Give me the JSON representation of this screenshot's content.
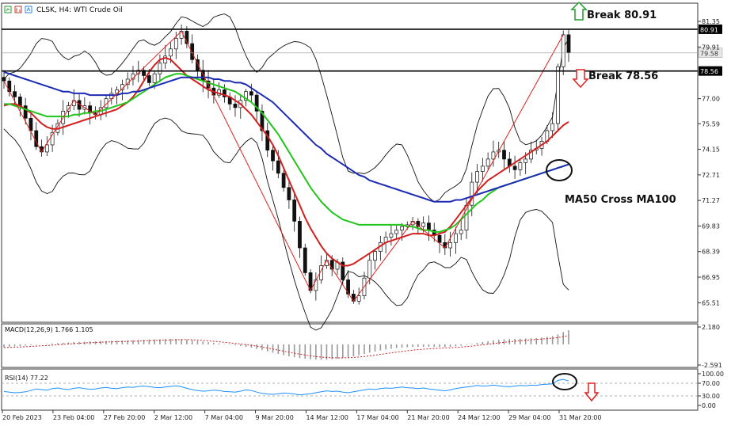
{
  "header": {
    "title": "CLSK, H4:  WTI Crude Oil"
  },
  "annotations": {
    "break_up": "Break 80.91",
    "break_down": "Break 78.56",
    "ma_cross": "MA50 Cross MA100"
  },
  "colors": {
    "candle": "#111111",
    "ma_fast": "#d21f1f",
    "ma_mid": "#22c51a",
    "ma_slow": "#1c2bb4",
    "bands": "#111111",
    "zigzag": "#e0211d",
    "macd": "#999999",
    "macd_signal": "#cc2222",
    "rsi": "#1e90ff",
    "arrow_up": "#1f9e2e",
    "arrow_down": "#e02020"
  },
  "chart_data": [
    {
      "type": "line",
      "panel": "price",
      "symbol": "CLSK",
      "timeframe": "H4",
      "ylim": [
        64.5,
        82.2
      ],
      "y_ticks": [
        "81.35",
        "79.91",
        "77.00",
        "75.59",
        "74.15",
        "72.71",
        "71.27",
        "69.83",
        "68.39",
        "66.95",
        "65.51"
      ],
      "current_price": "79.58",
      "levels": [
        {
          "value": 80.91,
          "label": "80.91"
        },
        {
          "value": 78.56,
          "label": "78.56"
        }
      ],
      "x_labels": [
        "20 Feb 2023",
        "23 Feb 04:00",
        "27 Feb 20:00",
        "2 Mar 12:00",
        "7 Mar 04:00",
        "9 Mar 20:00",
        "14 Mar 12:00",
        "17 Mar 04:00",
        "21 Mar 20:00",
        "24 Mar 12:00",
        "29 Mar 04:00",
        "31 Mar 20:00"
      ],
      "close": [
        78.0,
        77.4,
        77.1,
        76.6,
        75.9,
        75.2,
        74.3,
        74.0,
        74.4,
        75.1,
        75.6,
        76.3,
        76.6,
        76.9,
        76.4,
        76.6,
        76.2,
        76.1,
        76.5,
        77.0,
        77.3,
        77.5,
        77.8,
        78.1,
        78.4,
        78.6,
        78.3,
        77.9,
        78.4,
        79.0,
        79.4,
        79.8,
        80.4,
        80.8,
        80.1,
        79.2,
        78.6,
        78.0,
        77.6,
        77.2,
        77.5,
        77.1,
        76.7,
        76.5,
        76.9,
        77.4,
        77.2,
        76.3,
        75.2,
        74.1,
        73.5,
        72.8,
        72.0,
        71.3,
        70.1,
        68.6,
        67.2,
        66.2,
        66.8,
        67.6,
        67.9,
        67.4,
        67.8,
        66.8,
        66.0,
        65.6,
        65.9,
        66.9,
        67.9,
        68.4,
        68.9,
        69.2,
        69.4,
        69.6,
        69.8,
        69.9,
        70.1,
        69.8,
        70.0,
        69.6,
        69.3,
        68.9,
        68.6,
        68.9,
        69.4,
        69.6,
        71.0,
        72.3,
        72.9,
        73.2,
        73.6,
        74.0,
        74.1,
        73.6,
        73.2,
        73.0,
        73.4,
        73.6,
        74.1,
        74.2,
        74.6,
        75.2,
        75.6,
        78.8,
        80.6,
        79.6
      ],
      "series": [
        {
          "role": "ma_fast",
          "values": [
            76.6,
            76.7,
            76.7,
            76.6,
            76.4,
            76.2,
            75.9,
            75.6,
            75.4,
            75.3,
            75.3,
            75.4,
            75.5,
            75.6,
            75.7,
            75.8,
            75.9,
            76.0,
            76.1,
            76.2,
            76.3,
            76.4,
            76.6,
            76.8,
            77.1,
            77.5,
            78.0,
            78.5,
            78.9,
            79.2,
            79.3,
            79.2,
            78.9,
            78.6,
            78.3,
            78.1,
            77.9,
            77.7,
            77.5,
            77.4,
            77.3,
            77.2,
            77.1,
            76.9,
            76.7,
            76.4,
            76.1,
            75.7,
            75.3,
            74.9,
            74.4,
            73.8,
            73.1,
            72.4,
            71.7,
            71.0,
            70.3,
            69.7,
            69.2,
            68.7,
            68.3,
            68.0,
            67.8,
            67.6,
            67.6,
            67.7,
            67.9,
            68.1,
            68.3,
            68.5,
            68.7,
            68.9,
            69.0,
            69.1,
            69.2,
            69.3,
            69.4,
            69.4,
            69.4,
            69.3,
            69.3,
            69.4,
            69.5,
            69.8,
            70.2,
            70.6,
            71.0,
            71.4,
            71.8,
            72.1,
            72.4,
            72.6,
            72.8,
            73.0,
            73.2,
            73.4,
            73.6,
            73.8,
            74.0,
            74.2,
            74.4,
            74.6,
            74.9,
            75.2,
            75.5,
            75.7
          ]
        },
        {
          "role": "ma_mid",
          "values": [
            76.7,
            76.7,
            76.6,
            76.5,
            76.4,
            76.3,
            76.2,
            76.1,
            76.0,
            76.0,
            76.0,
            76.0,
            76.0,
            76.1,
            76.1,
            76.2,
            76.2,
            76.3,
            76.3,
            76.4,
            76.5,
            76.6,
            76.7,
            76.8,
            77.0,
            77.2,
            77.4,
            77.6,
            77.8,
            78.0,
            78.2,
            78.3,
            78.4,
            78.4,
            78.3,
            78.2,
            78.1,
            78.0,
            77.9,
            77.8,
            77.7,
            77.6,
            77.5,
            77.4,
            77.2,
            77.0,
            76.8,
            76.5,
            76.2,
            75.8,
            75.4,
            75.0,
            74.5,
            74.0,
            73.5,
            73.0,
            72.5,
            72.0,
            71.6,
            71.2,
            70.9,
            70.6,
            70.4,
            70.2,
            70.1,
            70.0,
            69.9,
            69.9,
            69.9,
            69.9,
            69.9,
            69.9,
            69.9,
            69.9,
            69.9,
            69.8,
            69.8,
            69.7,
            69.6,
            69.6,
            69.5,
            69.5,
            69.6,
            69.7,
            69.9,
            70.2,
            70.5,
            70.8,
            71.1,
            71.3,
            71.6,
            71.8,
            72.0,
            72.1,
            72.2,
            72.3,
            72.4,
            72.5,
            72.6,
            72.7,
            72.8,
            72.9,
            73.0,
            73.1,
            73.2,
            73.3
          ]
        },
        {
          "role": "ma_slow",
          "values": [
            78.5,
            78.4,
            78.3,
            78.2,
            78.1,
            78.0,
            77.9,
            77.8,
            77.7,
            77.6,
            77.5,
            77.4,
            77.4,
            77.3,
            77.3,
            77.3,
            77.2,
            77.2,
            77.2,
            77.2,
            77.2,
            77.2,
            77.3,
            77.3,
            77.4,
            77.4,
            77.5,
            77.6,
            77.7,
            77.8,
            77.9,
            78.0,
            78.1,
            78.2,
            78.2,
            78.2,
            78.2,
            78.2,
            78.2,
            78.1,
            78.1,
            78.0,
            78.0,
            77.9,
            77.9,
            77.8,
            77.6,
            77.4,
            77.2,
            77.0,
            76.8,
            76.5,
            76.2,
            75.9,
            75.6,
            75.3,
            75.0,
            74.7,
            74.4,
            74.2,
            73.9,
            73.7,
            73.5,
            73.3,
            73.1,
            72.9,
            72.7,
            72.6,
            72.4,
            72.3,
            72.2,
            72.1,
            72.0,
            71.9,
            71.8,
            71.7,
            71.6,
            71.5,
            71.4,
            71.3,
            71.2,
            71.2,
            71.2,
            71.2,
            71.3,
            71.3,
            71.4,
            71.5,
            71.6,
            71.7,
            71.8,
            71.9,
            72.0,
            72.1,
            72.2,
            72.3,
            72.4,
            72.5,
            72.6,
            72.7,
            72.8,
            72.9,
            73.0,
            73.1,
            73.2,
            73.3
          ]
        }
      ],
      "zigzag": [
        [
          0,
          78.0
        ],
        [
          7,
          74.0
        ],
        [
          13,
          76.9
        ],
        [
          17,
          76.1
        ],
        [
          33,
          80.8
        ],
        [
          57,
          66.2
        ],
        [
          60,
          67.9
        ],
        [
          65,
          65.6
        ],
        [
          76,
          70.1
        ],
        [
          82,
          68.6
        ],
        [
          104,
          80.6
        ]
      ]
    },
    {
      "type": "bar",
      "panel": "macd",
      "title": "MACD(12,26,9) 1.766 1.105",
      "y_ticks": [
        "2.180",
        "-2.591"
      ],
      "ylim": [
        -2.591,
        2.18
      ],
      "values": [
        -0.35,
        -0.3,
        -0.25,
        -0.2,
        -0.15,
        -0.1,
        -0.05,
        0.0,
        0.05,
        0.1,
        0.15,
        0.2,
        0.25,
        0.3,
        0.32,
        0.34,
        0.36,
        0.38,
        0.4,
        0.42,
        0.44,
        0.46,
        0.48,
        0.5,
        0.52,
        0.55,
        0.58,
        0.6,
        0.62,
        0.64,
        0.66,
        0.68,
        0.7,
        0.66,
        0.6,
        0.52,
        0.44,
        0.36,
        0.28,
        0.2,
        0.12,
        0.04,
        -0.04,
        -0.12,
        -0.2,
        -0.3,
        -0.42,
        -0.56,
        -0.72,
        -0.88,
        -1.04,
        -1.2,
        -1.36,
        -1.5,
        -1.62,
        -1.72,
        -1.8,
        -1.86,
        -1.9,
        -1.92,
        -1.9,
        -1.86,
        -1.8,
        -1.72,
        -1.62,
        -1.5,
        -1.36,
        -1.2,
        -1.04,
        -0.9,
        -0.76,
        -0.64,
        -0.54,
        -0.46,
        -0.4,
        -0.36,
        -0.33,
        -0.31,
        -0.3,
        -0.3,
        -0.31,
        -0.32,
        -0.33,
        -0.3,
        -0.24,
        -0.16,
        -0.06,
        0.06,
        0.18,
        0.3,
        0.4,
        0.5,
        0.58,
        0.64,
        0.68,
        0.7,
        0.72,
        0.74,
        0.76,
        0.8,
        0.86,
        0.94,
        1.04,
        1.25,
        1.55,
        1.77
      ],
      "signal": [
        -0.4,
        -0.38,
        -0.35,
        -0.32,
        -0.29,
        -0.26,
        -0.22,
        -0.18,
        -0.14,
        -0.1,
        -0.05,
        0.0,
        0.05,
        0.1,
        0.14,
        0.18,
        0.21,
        0.24,
        0.27,
        0.3,
        0.32,
        0.34,
        0.36,
        0.38,
        0.4,
        0.42,
        0.45,
        0.47,
        0.5,
        0.52,
        0.54,
        0.56,
        0.58,
        0.6,
        0.6,
        0.58,
        0.55,
        0.5,
        0.45,
        0.39,
        0.33,
        0.26,
        0.19,
        0.12,
        0.05,
        -0.03,
        -0.12,
        -0.22,
        -0.33,
        -0.45,
        -0.58,
        -0.71,
        -0.85,
        -0.98,
        -1.11,
        -1.23,
        -1.34,
        -1.44,
        -1.53,
        -1.6,
        -1.65,
        -1.68,
        -1.7,
        -1.7,
        -1.68,
        -1.64,
        -1.59,
        -1.52,
        -1.44,
        -1.35,
        -1.26,
        -1.16,
        -1.06,
        -0.97,
        -0.88,
        -0.8,
        -0.72,
        -0.66,
        -0.6,
        -0.55,
        -0.51,
        -0.48,
        -0.45,
        -0.42,
        -0.38,
        -0.34,
        -0.28,
        -0.22,
        -0.14,
        -0.06,
        0.02,
        0.1,
        0.18,
        0.26,
        0.33,
        0.4,
        0.46,
        0.52,
        0.57,
        0.62,
        0.67,
        0.72,
        0.78,
        0.86,
        0.98,
        1.11
      ]
    },
    {
      "type": "line",
      "panel": "rsi",
      "title": "RSI(14) 77.22",
      "y_ticks": [
        "100.00",
        "70.00",
        "30.00",
        "0.00"
      ],
      "ylim": [
        0,
        100
      ],
      "levels": [
        70,
        30
      ],
      "values": [
        44,
        42,
        40,
        41,
        43,
        47,
        52,
        50,
        48,
        53,
        55,
        52,
        50,
        54,
        56,
        53,
        51,
        52,
        55,
        57,
        54,
        53,
        56,
        58,
        57,
        60,
        61,
        59,
        57,
        56,
        58,
        60,
        62,
        59,
        54,
        50,
        47,
        45,
        46,
        48,
        47,
        44,
        43,
        42,
        45,
        49,
        47,
        42,
        38,
        36,
        35,
        37,
        39,
        38,
        36,
        33,
        35,
        37,
        40,
        43,
        46,
        44,
        45,
        42,
        40,
        43,
        46,
        49,
        52,
        50,
        53,
        55,
        54,
        56,
        58,
        56,
        55,
        53,
        55,
        52,
        50,
        48,
        46,
        49,
        53,
        56,
        58,
        60,
        63,
        61,
        62,
        64,
        62,
        60,
        59,
        61,
        63,
        62,
        64,
        63,
        66,
        67,
        68,
        79,
        82,
        77
      ]
    }
  ]
}
